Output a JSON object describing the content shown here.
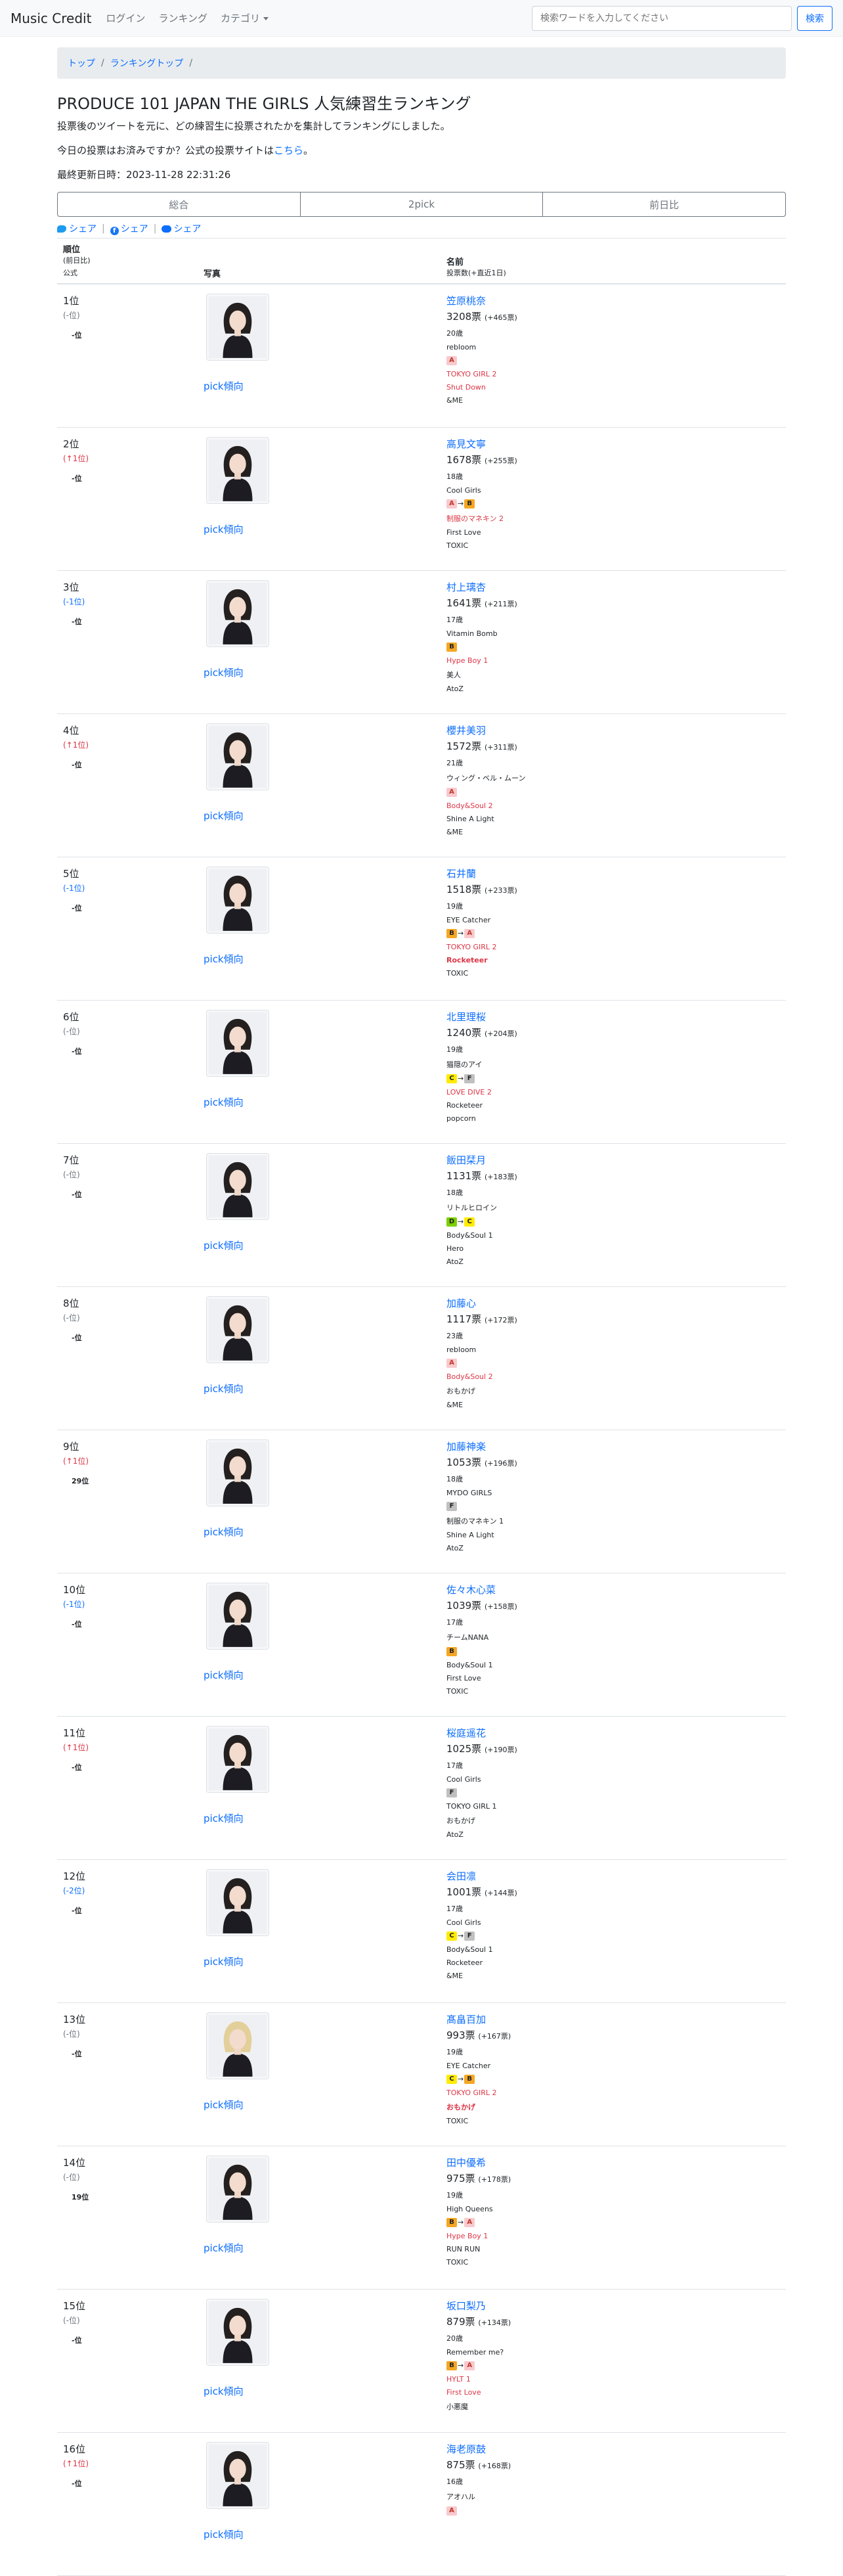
{
  "navbar": {
    "brand": "Music Credit",
    "login": "ログイン",
    "ranking": "ランキング",
    "category": "カテゴリ",
    "search_placeholder": "検索ワードを入力してください",
    "search_button": "検索"
  },
  "breadcrumb": {
    "home": "トップ",
    "ranking": "ランキングトップ",
    "sep": "/"
  },
  "page": {
    "title": "PRODUCE 101 JAPAN THE GIRLS 人気練習生ランキング",
    "description": "投票後のツイートを元に、どの練習生に投票されたかを集計してランキングにしました。",
    "vote_prompt": "今日の投票はお済みですか？公式の投票サイトは",
    "vote_link": "こちら",
    "vote_suffix": "。",
    "updated": "最終更新日時：2023-11-28 22:31:26"
  },
  "tabs": [
    "総合",
    "2pick",
    "前日比"
  ],
  "share": {
    "twitter": "シェア",
    "facebook": "シェア",
    "line": "シェア",
    "sep": "|"
  },
  "table_headers": {
    "rank": "順位",
    "rank_sub1": "(前日比)",
    "rank_sub2": "公式",
    "photo": "写真",
    "name": "名前",
    "name_sub": "投票数(+直近1日)"
  },
  "pick_label": "pick傾向",
  "grade_colors": {
    "A": "#f8c9cd",
    "B": "#f5a623",
    "C": "#ffeb00",
    "D": "#7bd000",
    "F": "#c0c0c0"
  },
  "rows": [
    {
      "rank": "1位",
      "delta": "(-位)",
      "dir": "same",
      "official": "-位",
      "name": "笠原桃奈",
      "votes": "3208票",
      "inc": "(+465票)",
      "age": "20歳",
      "song": "rebloom",
      "grades": [
        "A"
      ],
      "lines": [
        {
          "t": "TOKYO GIRL 2",
          "c": "red"
        },
        {
          "t": "Shut Down",
          "c": "red"
        },
        {
          "t": "&ME",
          "c": ""
        }
      ]
    },
    {
      "rank": "2位",
      "delta": "(↑1位)",
      "dir": "up",
      "official": "-位",
      "name": "高見文寧",
      "votes": "1678票",
      "inc": "(+255票)",
      "age": "18歳",
      "song": "Cool Girls",
      "grades": [
        "A",
        "B"
      ],
      "lines": [
        {
          "t": "制服のマネキン 2",
          "c": "red"
        },
        {
          "t": "First Love",
          "c": ""
        },
        {
          "t": "TOXIC",
          "c": ""
        }
      ]
    },
    {
      "rank": "3位",
      "delta": "(-1位)",
      "dir": "down",
      "official": "-位",
      "name": "村上璃杏",
      "votes": "1641票",
      "inc": "(+211票)",
      "age": "17歳",
      "song": "Vitamin Bomb",
      "grades": [
        "B"
      ],
      "lines": [
        {
          "t": "Hype Boy 1",
          "c": "red"
        },
        {
          "t": "美人",
          "c": ""
        },
        {
          "t": "AtoZ",
          "c": ""
        }
      ]
    },
    {
      "rank": "4位",
      "delta": "(↑1位)",
      "dir": "up",
      "official": "-位",
      "name": "櫻井美羽",
      "votes": "1572票",
      "inc": "(+311票)",
      "age": "21歳",
      "song": "ウィング・ベル・ムーン",
      "grades": [
        "A"
      ],
      "lines": [
        {
          "t": "Body&Soul 2",
          "c": "red"
        },
        {
          "t": "Shine A Light",
          "c": ""
        },
        {
          "t": "&ME",
          "c": ""
        }
      ]
    },
    {
      "rank": "5位",
      "delta": "(-1位)",
      "dir": "down",
      "official": "-位",
      "name": "石井蘭",
      "votes": "1518票",
      "inc": "(+233票)",
      "age": "19歳",
      "song": "EYE Catcher",
      "grades": [
        "B",
        "A"
      ],
      "lines": [
        {
          "t": "TOKYO GIRL 2",
          "c": "red"
        },
        {
          "t": "Rocketeer",
          "c": "redb"
        },
        {
          "t": "TOXIC",
          "c": ""
        }
      ]
    },
    {
      "rank": "6位",
      "delta": "(-位)",
      "dir": "same",
      "official": "-位",
      "name": "北里理桜",
      "votes": "1240票",
      "inc": "(+204票)",
      "age": "19歳",
      "song": "猫隠のアイ",
      "grades": [
        "C",
        "F"
      ],
      "lines": [
        {
          "t": "LOVE DIVE 2",
          "c": "red"
        },
        {
          "t": "Rocketeer",
          "c": ""
        },
        {
          "t": "popcorn",
          "c": ""
        }
      ]
    },
    {
      "rank": "7位",
      "delta": "(-位)",
      "dir": "same",
      "official": "-位",
      "name": "飯田栞月",
      "votes": "1131票",
      "inc": "(+183票)",
      "age": "18歳",
      "song": "リトルヒロイン",
      "grades": [
        "D",
        "C"
      ],
      "lines": [
        {
          "t": "Body&Soul 1",
          "c": ""
        },
        {
          "t": "Hero",
          "c": ""
        },
        {
          "t": "AtoZ",
          "c": ""
        }
      ]
    },
    {
      "rank": "8位",
      "delta": "(-位)",
      "dir": "same",
      "official": "-位",
      "name": "加藤心",
      "votes": "1117票",
      "inc": "(+172票)",
      "age": "23歳",
      "song": "rebloom",
      "grades": [
        "A"
      ],
      "lines": [
        {
          "t": "Body&Soul 2",
          "c": "red"
        },
        {
          "t": "おもかげ",
          "c": ""
        },
        {
          "t": "&ME",
          "c": ""
        }
      ]
    },
    {
      "rank": "9位",
      "delta": "(↑1位)",
      "dir": "up",
      "official": "29位",
      "name": "加藤神楽",
      "votes": "1053票",
      "inc": "(+196票)",
      "age": "18歳",
      "song": "MYDO GIRLS",
      "grades": [
        "F"
      ],
      "lines": [
        {
          "t": "制服のマネキン 1",
          "c": ""
        },
        {
          "t": "Shine A Light",
          "c": ""
        },
        {
          "t": "AtoZ",
          "c": ""
        }
      ]
    },
    {
      "rank": "10位",
      "delta": "(-1位)",
      "dir": "down",
      "official": "-位",
      "name": "佐々木心菜",
      "votes": "1039票",
      "inc": "(+158票)",
      "age": "17歳",
      "song": "チームNANA",
      "grades": [
        "B"
      ],
      "lines": [
        {
          "t": "Body&Soul 1",
          "c": ""
        },
        {
          "t": "First Love",
          "c": ""
        },
        {
          "t": "TOXIC",
          "c": ""
        }
      ]
    },
    {
      "rank": "11位",
      "delta": "(↑1位)",
      "dir": "up",
      "official": "-位",
      "name": "桜庭遥花",
      "votes": "1025票",
      "inc": "(+190票)",
      "age": "17歳",
      "song": "Cool Girls",
      "grades": [
        "F"
      ],
      "lines": [
        {
          "t": "TOKYO GIRL 1",
          "c": ""
        },
        {
          "t": "おもかげ",
          "c": ""
        },
        {
          "t": "AtoZ",
          "c": ""
        }
      ]
    },
    {
      "rank": "12位",
      "delta": "(-2位)",
      "dir": "down",
      "official": "-位",
      "name": "会田凛",
      "votes": "1001票",
      "inc": "(+144票)",
      "age": "17歳",
      "song": "Cool Girls",
      "grades": [
        "C",
        "F"
      ],
      "lines": [
        {
          "t": "Body&Soul 1",
          "c": ""
        },
        {
          "t": "Rocketeer",
          "c": ""
        },
        {
          "t": "&ME",
          "c": ""
        }
      ]
    },
    {
      "rank": "13位",
      "delta": "(-位)",
      "dir": "same",
      "official": "-位",
      "name": "髙畠百加",
      "votes": "993票",
      "inc": "(+167票)",
      "age": "19歳",
      "song": "EYE Catcher",
      "grades": [
        "C",
        "B"
      ],
      "lines": [
        {
          "t": "TOKYO GIRL 2",
          "c": "red"
        },
        {
          "t": "おもかげ",
          "c": "redb"
        },
        {
          "t": "TOXIC",
          "c": ""
        }
      ]
    },
    {
      "rank": "14位",
      "delta": "(-位)",
      "dir": "same",
      "official": "19位",
      "name": "田中優希",
      "votes": "975票",
      "inc": "(+178票)",
      "age": "19歳",
      "song": "High Queens",
      "grades": [
        "B",
        "A"
      ],
      "lines": [
        {
          "t": "Hype Boy 1",
          "c": "red"
        },
        {
          "t": "RUN RUN",
          "c": ""
        },
        {
          "t": "TOXIC",
          "c": ""
        }
      ]
    },
    {
      "rank": "15位",
      "delta": "(-位)",
      "dir": "same",
      "official": "-位",
      "name": "坂口梨乃",
      "votes": "879票",
      "inc": "(+134票)",
      "age": "20歳",
      "song": "Remember me?",
      "grades": [
        "B",
        "A"
      ],
      "lines": [
        {
          "t": "HYLT 1",
          "c": "red"
        },
        {
          "t": "First Love",
          "c": "red"
        },
        {
          "t": "小悪魔",
          "c": ""
        }
      ]
    },
    {
      "rank": "16位",
      "delta": "(↑1位)",
      "dir": "up",
      "official": "-位",
      "name": "海老原鼓",
      "votes": "875票",
      "inc": "(+168票)",
      "age": "16歳",
      "song": "アオハル",
      "grades": [
        "A"
      ],
      "lines": []
    }
  ]
}
